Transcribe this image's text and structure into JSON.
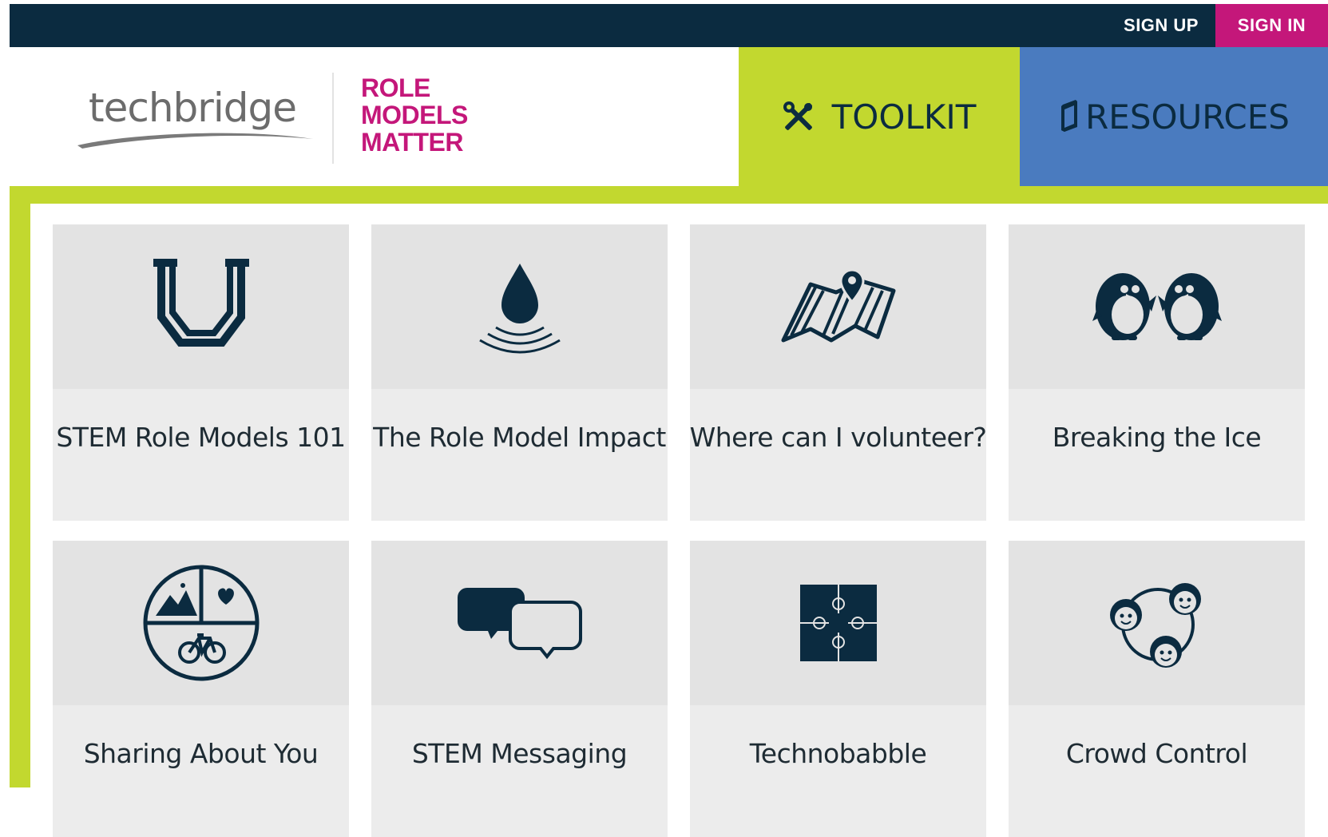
{
  "topbar": {
    "signup_label": "SIGN UP",
    "signin_label": "SIGN IN"
  },
  "header": {
    "logo_text": "techbridge",
    "tagline": [
      "ROLE",
      "MODELS",
      "MATTER"
    ],
    "tabs": [
      {
        "label": "TOOLKIT",
        "icon": "tools-icon",
        "color": "#c2d82f"
      },
      {
        "label": "RESOURCES",
        "icon": "book-icon",
        "color": "#4a7bbf"
      }
    ]
  },
  "colors": {
    "navy": "#0b2b40",
    "magenta": "#c4177a",
    "lime": "#c2d82f",
    "blue": "#4a7bbf"
  },
  "cards": [
    {
      "label": "STEM Role Models 101",
      "icon": "u-magnet-icon"
    },
    {
      "label": "The Role Model Impact",
      "icon": "water-drop-ripple-icon"
    },
    {
      "label": "Where can I volunteer?",
      "icon": "map-pin-icon"
    },
    {
      "label": "Breaking the Ice",
      "icon": "penguins-icon"
    },
    {
      "label": "Sharing About You",
      "icon": "interests-circle-icon"
    },
    {
      "label": "STEM Messaging",
      "icon": "chat-bubbles-icon"
    },
    {
      "label": "Technobabble",
      "icon": "puzzle-icon"
    },
    {
      "label": "Crowd Control",
      "icon": "group-faces-icon"
    }
  ]
}
